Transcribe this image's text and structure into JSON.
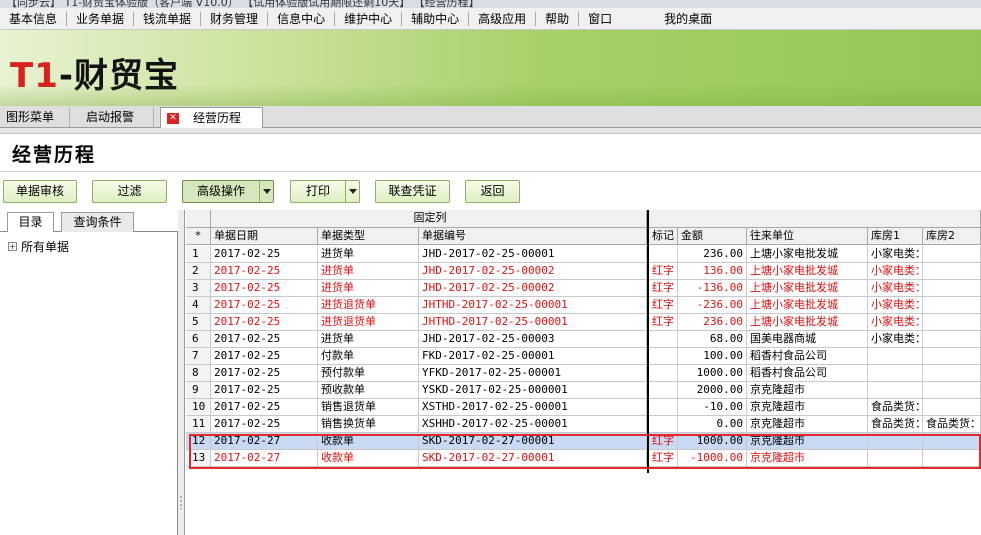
{
  "window": {
    "title_partial": "【同步云】 T1-财贸宝体验版（客户端 V10.0） 【试用体验版试用期限还剩10天】 【经营历程】"
  },
  "menu": {
    "items": [
      "基本信息",
      "业务单据",
      "钱流单据",
      "财务管理",
      "信息中心",
      "维护中心",
      "辅助中心",
      "高级应用",
      "帮助",
      "窗口"
    ],
    "desktop": "我的桌面"
  },
  "brand": {
    "logo_t1": "T1",
    "logo_rest": "-财贸宝",
    "accent": "#d8231c",
    "banner_green": "#a8d06a"
  },
  "tabs": [
    {
      "label": "图形菜单"
    },
    {
      "label": "启动报警"
    },
    {
      "label": "经营历程",
      "active": true,
      "close_icon": "close-icon"
    }
  ],
  "page": {
    "title": "经营历程"
  },
  "toolbar": {
    "audit": "单据审核",
    "filter": "过滤",
    "advanced": "高级操作",
    "print": "打印",
    "voucher": "联查凭证",
    "back": "返回"
  },
  "left": {
    "tab_catalog": "目录",
    "tab_query": "查询条件",
    "tree_root": "所有单据"
  },
  "grid": {
    "fixed_group": "固定列",
    "corner": "*",
    "columns": [
      "单据日期",
      "单据类型",
      "单据编号",
      "标记",
      "金额",
      "往来单位",
      "库房1",
      "库房2"
    ],
    "rows": [
      {
        "n": "1",
        "date": "2017-02-25",
        "type": "进货单",
        "code": "JHD-2017-02-25-00001",
        "mark": "",
        "amount": "236.00",
        "party": "上塘小家电批发城",
        "wh1": "小家电类：",
        "wh2": "",
        "red": false,
        "selected": false
      },
      {
        "n": "2",
        "date": "2017-02-25",
        "type": "进货单",
        "code": "JHD-2017-02-25-00002",
        "mark": "红字",
        "amount": "136.00",
        "party": "上塘小家电批发城",
        "wh1": "小家电类：",
        "wh2": "",
        "red": true,
        "selected": false
      },
      {
        "n": "3",
        "date": "2017-02-25",
        "type": "进货单",
        "code": "JHD-2017-02-25-00002",
        "mark": "红字",
        "amount": "-136.00",
        "party": "上塘小家电批发城",
        "wh1": "小家电类：",
        "wh2": "",
        "red": true,
        "selected": false
      },
      {
        "n": "4",
        "date": "2017-02-25",
        "type": "进货退货单",
        "code": "JHTHD-2017-02-25-00001",
        "mark": "红字",
        "amount": "-236.00",
        "party": "上塘小家电批发城",
        "wh1": "小家电类：",
        "wh2": "",
        "red": true,
        "selected": false
      },
      {
        "n": "5",
        "date": "2017-02-25",
        "type": "进货退货单",
        "code": "JHTHD-2017-02-25-00001",
        "mark": "红字",
        "amount": "236.00",
        "party": "上塘小家电批发城",
        "wh1": "小家电类：",
        "wh2": "",
        "red": true,
        "selected": false
      },
      {
        "n": "6",
        "date": "2017-02-25",
        "type": "进货单",
        "code": "JHD-2017-02-25-00003",
        "mark": "",
        "amount": "68.00",
        "party": "国美电器商城",
        "wh1": "小家电类：",
        "wh2": "",
        "red": false,
        "selected": false
      },
      {
        "n": "7",
        "date": "2017-02-25",
        "type": "付款单",
        "code": "FKD-2017-02-25-00001",
        "mark": "",
        "amount": "100.00",
        "party": "稻香村食品公司",
        "wh1": "",
        "wh2": "",
        "red": false,
        "selected": false
      },
      {
        "n": "8",
        "date": "2017-02-25",
        "type": "预付款单",
        "code": "YFKD-2017-02-25-00001",
        "mark": "",
        "amount": "1000.00",
        "party": "稻香村食品公司",
        "wh1": "",
        "wh2": "",
        "red": false,
        "selected": false
      },
      {
        "n": "9",
        "date": "2017-02-25",
        "type": "预收款单",
        "code": "YSKD-2017-02-25-000001",
        "mark": "",
        "amount": "2000.00",
        "party": "京克隆超市",
        "wh1": "",
        "wh2": "",
        "red": false,
        "selected": false
      },
      {
        "n": "10",
        "date": "2017-02-25",
        "type": "销售退货单",
        "code": "XSTHD-2017-02-25-00001",
        "mark": "",
        "amount": "-10.00",
        "party": "京克隆超市",
        "wh1": "食品类货：",
        "wh2": "",
        "red": false,
        "selected": false
      },
      {
        "n": "11",
        "date": "2017-02-25",
        "type": "销售换货单",
        "code": "XSHHD-2017-02-25-00001",
        "mark": "",
        "amount": "0.00",
        "party": "京克隆超市",
        "wh1": "食品类货：",
        "wh2": "食品类货：",
        "red": false,
        "selected": false
      },
      {
        "n": "12",
        "date": "2017-02-27",
        "type": "收款单",
        "code": "SKD-2017-02-27-00001",
        "mark": "红字",
        "amount": "1000.00",
        "party": "京克隆超市",
        "wh1": "",
        "wh2": "",
        "red": false,
        "selected": true
      },
      {
        "n": "13",
        "date": "2017-02-27",
        "type": "收款单",
        "code": "SKD-2017-02-27-00001",
        "mark": "红字",
        "amount": "-1000.00",
        "party": "京克隆超市",
        "wh1": "",
        "wh2": "",
        "red": true,
        "selected": false
      }
    ],
    "highlight_color": "#e3282e",
    "selected_color": "#c7d9f3"
  }
}
